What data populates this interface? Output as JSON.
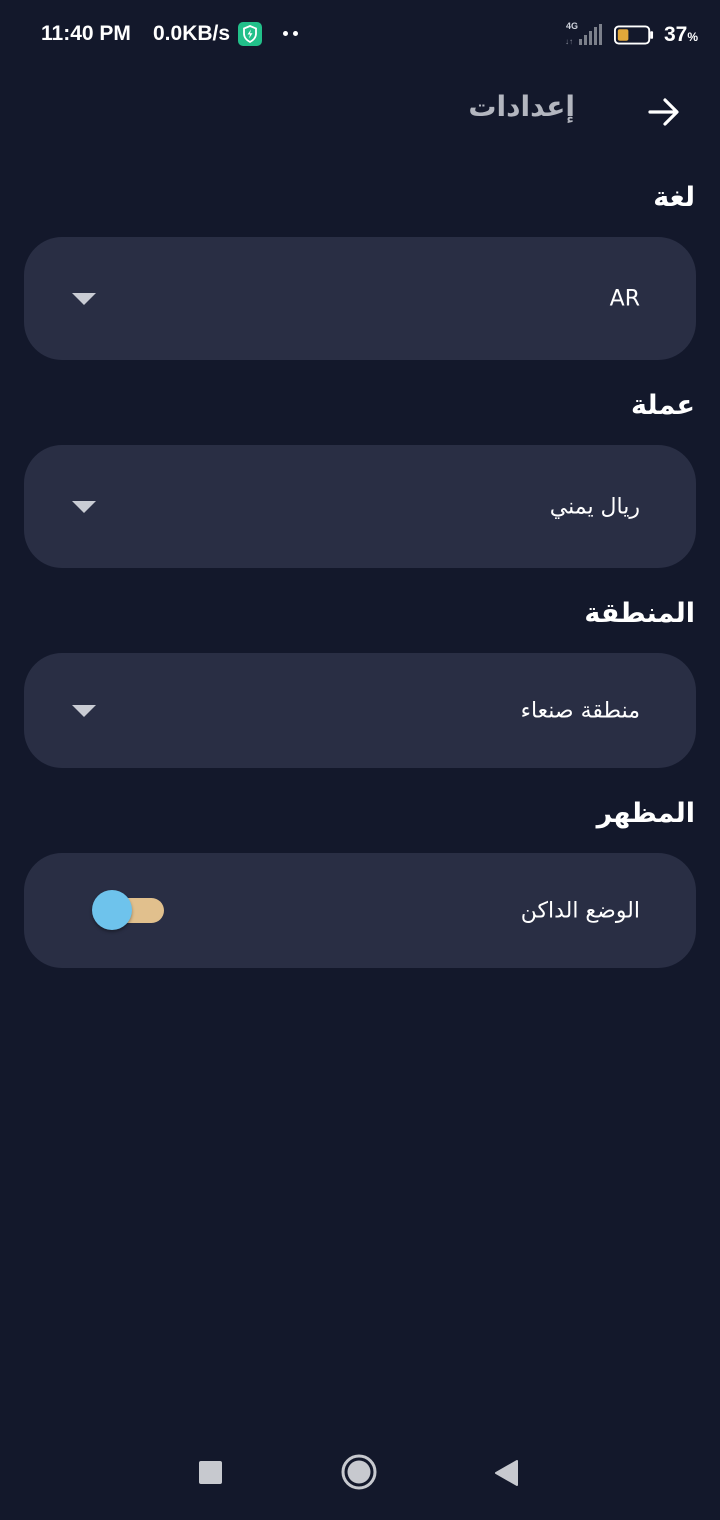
{
  "status_bar": {
    "time": "11:40 PM",
    "net_speed": "0.0KB/s",
    "network_type": "4G",
    "battery_percent": "37",
    "battery_unit": "%",
    "battery_level": 0.37,
    "battery_color": "#e3a83a",
    "shield_color": "#22c08a"
  },
  "header": {
    "title": "إعدادات",
    "back_icon": "arrow-right-icon"
  },
  "sections": {
    "language": {
      "label": "لغة",
      "value": "AR",
      "icon": "dropdown-arrow-icon"
    },
    "currency": {
      "label": "عملة",
      "value": "ريال يمني",
      "icon": "dropdown-arrow-icon"
    },
    "region": {
      "label": "المنطقة",
      "value": "منطقة صنعاء",
      "icon": "dropdown-arrow-icon"
    },
    "appearance": {
      "label": "المظهر",
      "dark_mode_label": "الوضع الداكن",
      "dark_mode_enabled": false
    }
  },
  "nav_bar": {
    "recents_icon": "square-icon",
    "home_icon": "circle-home-icon",
    "back_icon": "triangle-back-icon"
  },
  "colors": {
    "background": "#13182b",
    "card": "#292e44",
    "toggle_track": "#e1c08d",
    "toggle_thumb": "#6ec3ec",
    "title_muted": "#b3b6bf"
  }
}
